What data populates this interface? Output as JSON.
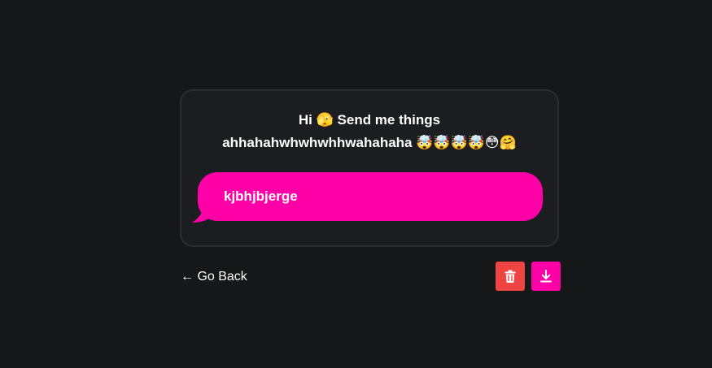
{
  "prompt": {
    "line1": "Hi 🫣 Send me things",
    "line2": "ahhahahwhwhwhhwahahaha 🤯🤯🤯🤯😳🤗"
  },
  "message": {
    "text": "kjbhjbjerge"
  },
  "nav": {
    "go_back_label": "← Go Back"
  },
  "actions": {
    "delete_icon": "trash-icon",
    "download_icon": "download-icon"
  },
  "colors": {
    "background": "#161719",
    "card": "#1c1d21",
    "card_border": "#2c2d31",
    "bubble": "#ff00a8",
    "delete": "#ef4444",
    "download": "#ff00a8"
  }
}
